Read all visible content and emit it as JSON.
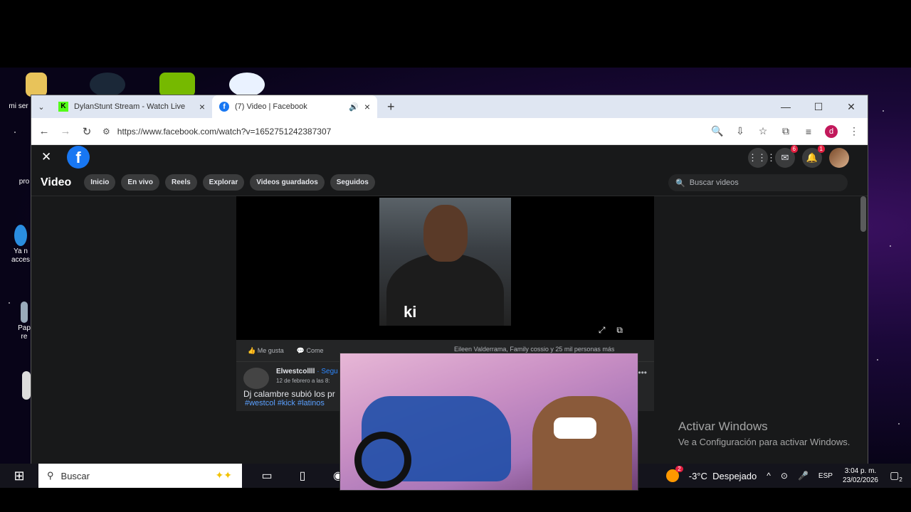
{
  "desktop": {
    "icons": [
      {
        "label": "mi ser"
      },
      {
        "label": "pro"
      },
      {
        "label": "Ya n\nacces"
      },
      {
        "label": "Pap\nre"
      }
    ]
  },
  "browser": {
    "tabs": [
      {
        "title": "DylanStunt Stream - Watch Live",
        "favicon": "kick-icon"
      },
      {
        "title": "(7) Video | Facebook",
        "favicon": "facebook-icon",
        "audio": true
      }
    ],
    "url": "https://www.facebook.com/watch?v=1652751242387307",
    "profile_initial": "d"
  },
  "facebook": {
    "nav_title": "Video",
    "nav_items": [
      "Inicio",
      "En vivo",
      "Reels",
      "Explorar",
      "Videos guardados",
      "Seguidos"
    ],
    "search_placeholder": "Buscar videos",
    "badges": {
      "messenger": "6",
      "notifications": "1"
    },
    "video_watermark": "ki",
    "actions": {
      "like": "Me gusta",
      "comment": "Come",
      "reactions": "Eileen Valderrama, Family cossio y 25 mil personas más"
    },
    "post": {
      "author": "Elwestcollll",
      "follow": "· Segu",
      "date": "12 de febrero a las 8:",
      "text": "Dj calambre subió los pr",
      "tags": "#westcol #kick #latinos"
    }
  },
  "activate_windows": {
    "line1": "Activar Windows",
    "line2": "Ve a Configuración para activar Windows."
  },
  "taskbar": {
    "search_placeholder": "Buscar",
    "weather": "-3°C  Despejado",
    "weather_badge": "2",
    "language": "ESP",
    "time": "3:04 p. m.",
    "date": "23/02/2026",
    "notif_count": "2"
  }
}
